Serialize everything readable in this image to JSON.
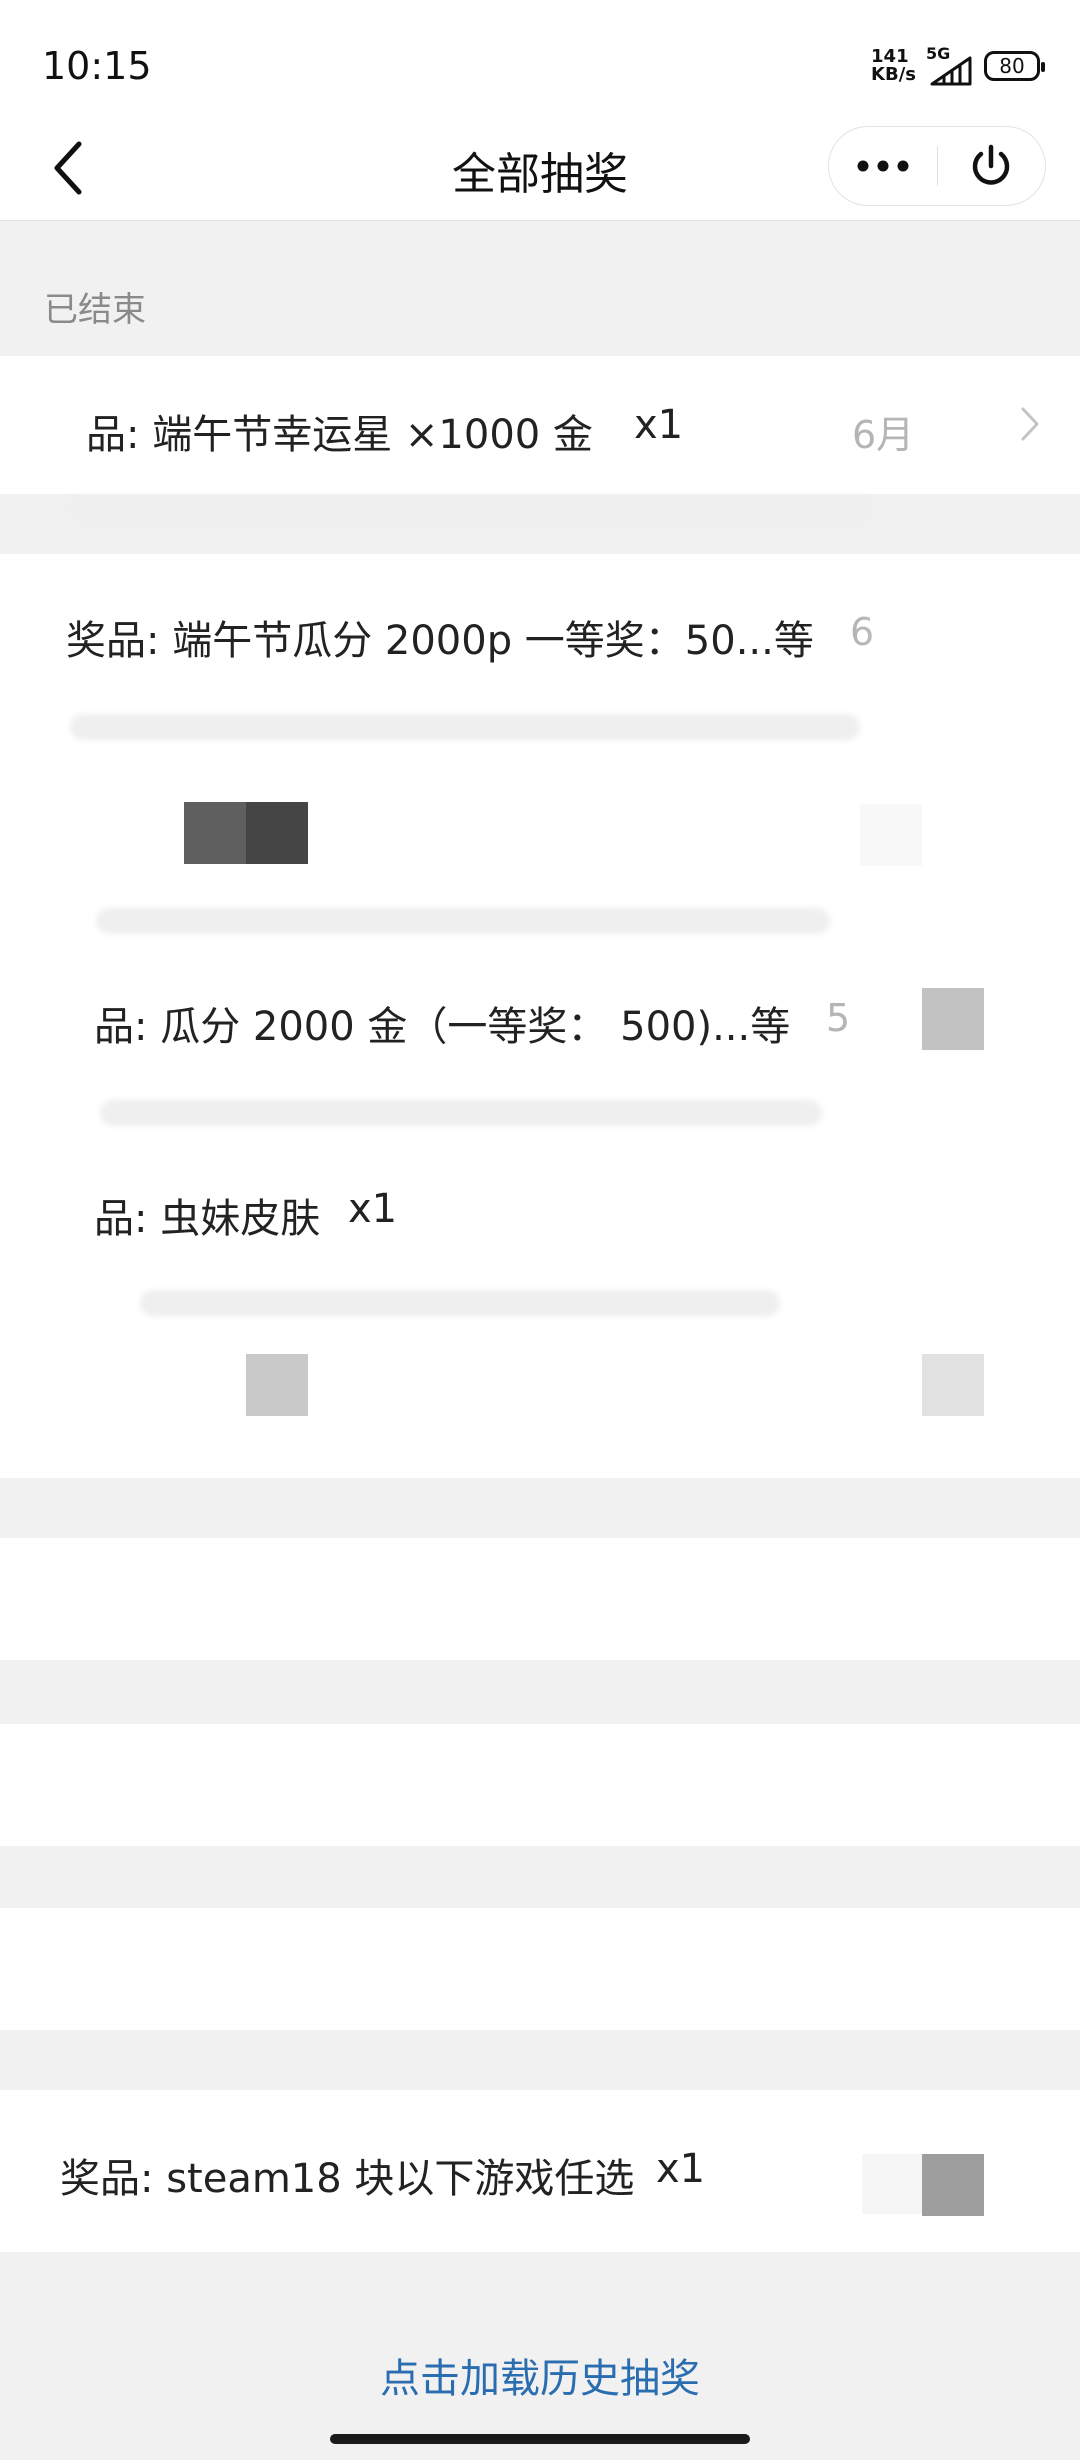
{
  "status_bar": {
    "time": "10:15",
    "net_speed_value": "141",
    "net_speed_unit": "KB/s",
    "network": "5G",
    "battery": "80"
  },
  "nav": {
    "title": "全部抽奖",
    "back_icon": "chevron-left-icon",
    "more_icon": "more-dots-icon",
    "power_icon": "power-icon"
  },
  "section": {
    "title": "已结束"
  },
  "lotteries": [
    {
      "prize": "品: 端午节幸运星 ×1000 金",
      "qty": "x1",
      "date": "6月"
    },
    {
      "prize": "奖品: 端午节瓜分 2000p 一等奖：50...等",
      "qty": "",
      "date": "6"
    },
    {
      "prize": "品: 瓜分 2000 金（一等奖： 500)...等",
      "qty": "",
      "date": "5"
    },
    {
      "prize": "品: 虫妹皮肤",
      "qty": "x1",
      "date": ""
    },
    {
      "prize": "奖品: steam18 块以下游戏任选",
      "qty": "x1",
      "date": ""
    }
  ],
  "load_more": "点击加载历史抽奖",
  "colors": {
    "accent_link": "#2a6db0",
    "background": "#f1f1f1",
    "card": "#ffffff"
  }
}
